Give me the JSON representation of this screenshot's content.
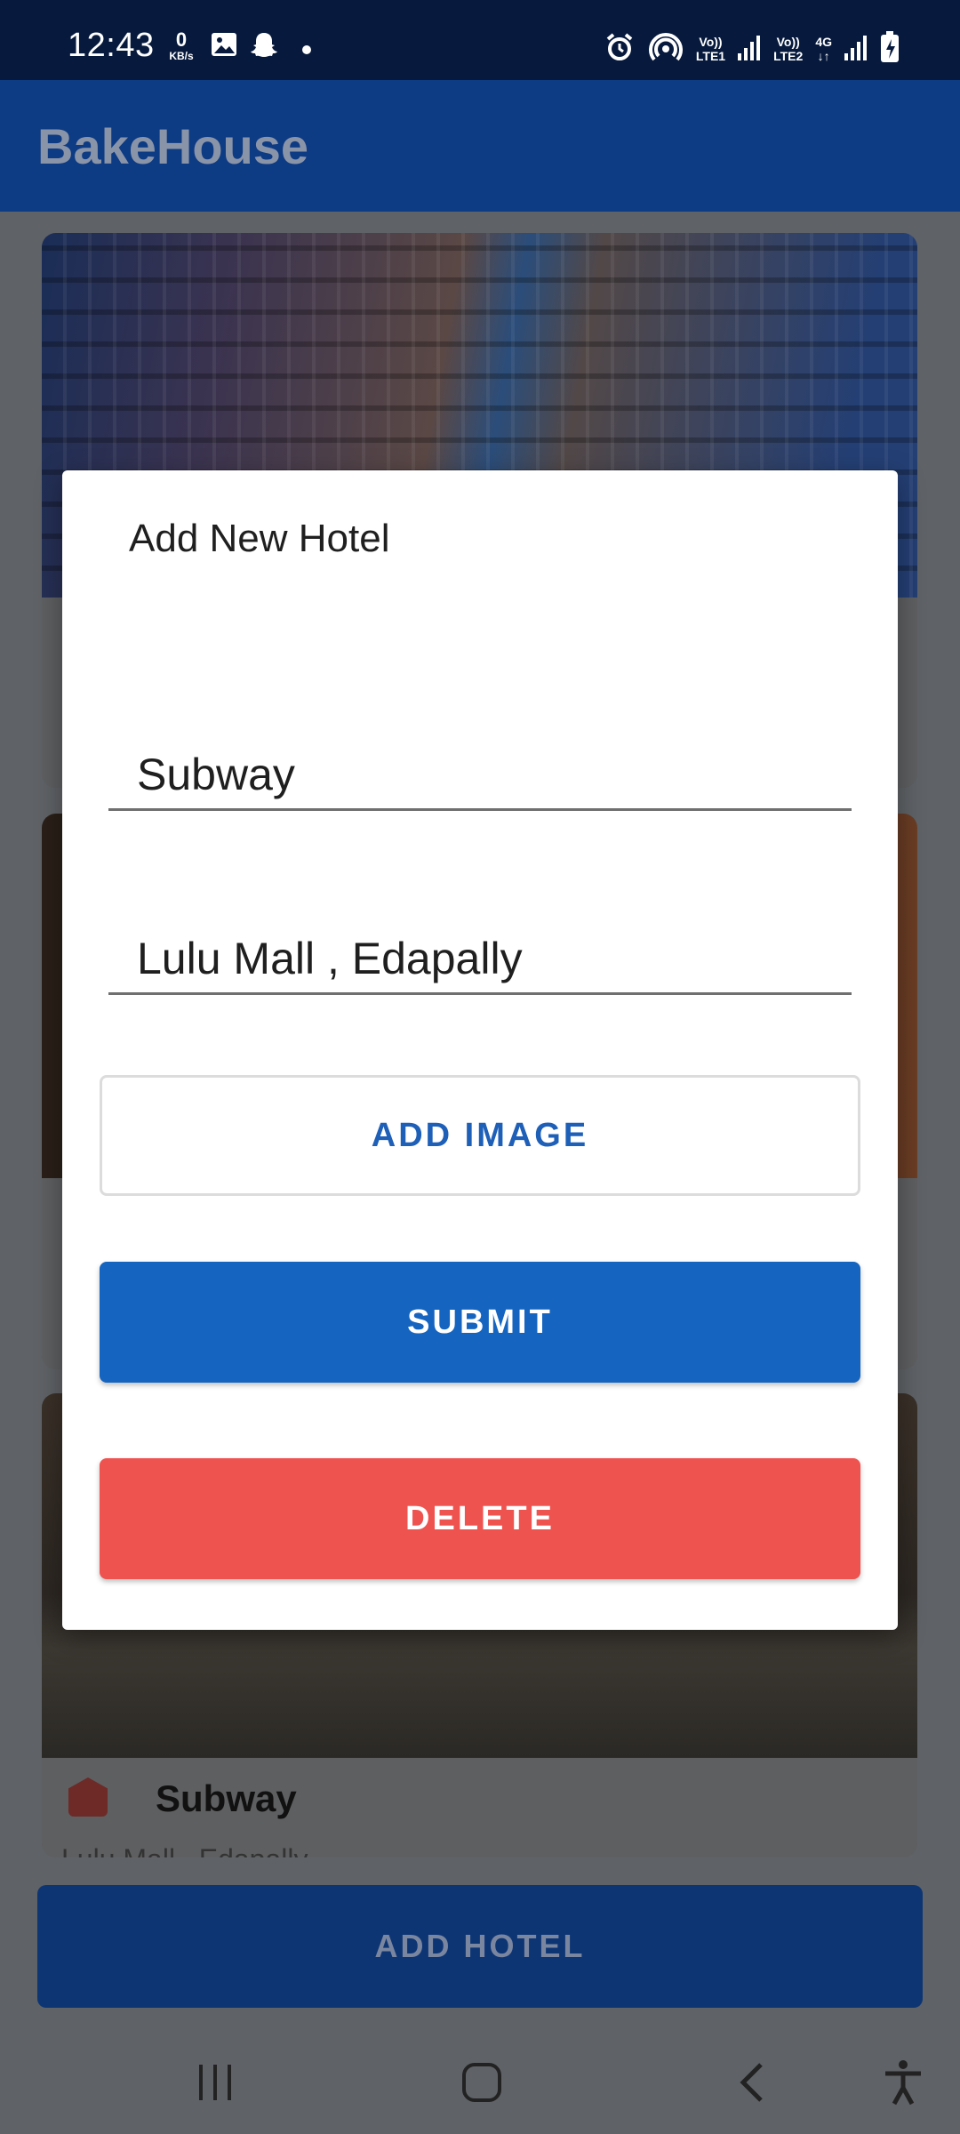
{
  "status_bar": {
    "time": "12:43",
    "net_speed_value": "0",
    "net_speed_unit": "KB/s",
    "sim1_label": "LTE1",
    "sim2_label": "LTE2",
    "volte": "Vo))",
    "network_type": "4G"
  },
  "app_bar": {
    "title": "BakeHouse"
  },
  "background_cards": [
    {
      "has_title": false
    },
    {
      "has_title": false
    },
    {
      "title": "Subway",
      "subtitle": "Lulu Mall , Edapally"
    }
  ],
  "add_hotel_button": {
    "label": "ADD HOTEL"
  },
  "dialog": {
    "title": "Add New Hotel",
    "name_field": {
      "value": "Subway"
    },
    "location_field": {
      "value": "Lulu Mall , Edapally"
    },
    "add_image_label": "ADD IMAGE",
    "submit_label": "SUBMIT",
    "delete_label": "DELETE"
  },
  "colors": {
    "primary": "#1565c0",
    "danger": "#ef5350",
    "app_bar": "#0d3b84"
  }
}
